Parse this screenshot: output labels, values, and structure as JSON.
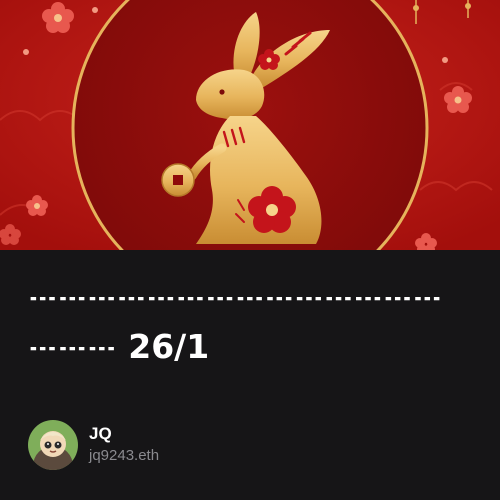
{
  "post": {
    "title_line1": "𝌀𝌀𝌀𝌀𝌀𝌀𝌀𝌀𝌀𝌀𝌀𝌀𝌀𝌀",
    "title_line2": "𝌀𝌀𝌀 26/1"
  },
  "author": {
    "name": "JQ",
    "handle": "jq9243.eth"
  },
  "banner": {
    "motif": "golden-rabbit-illustration",
    "background_color": "#b4130f",
    "disc_color": "#8e0b0a",
    "ring_color": "#e6b35c",
    "gold_color": "#e9b45a",
    "accent_color": "#c4141b"
  }
}
